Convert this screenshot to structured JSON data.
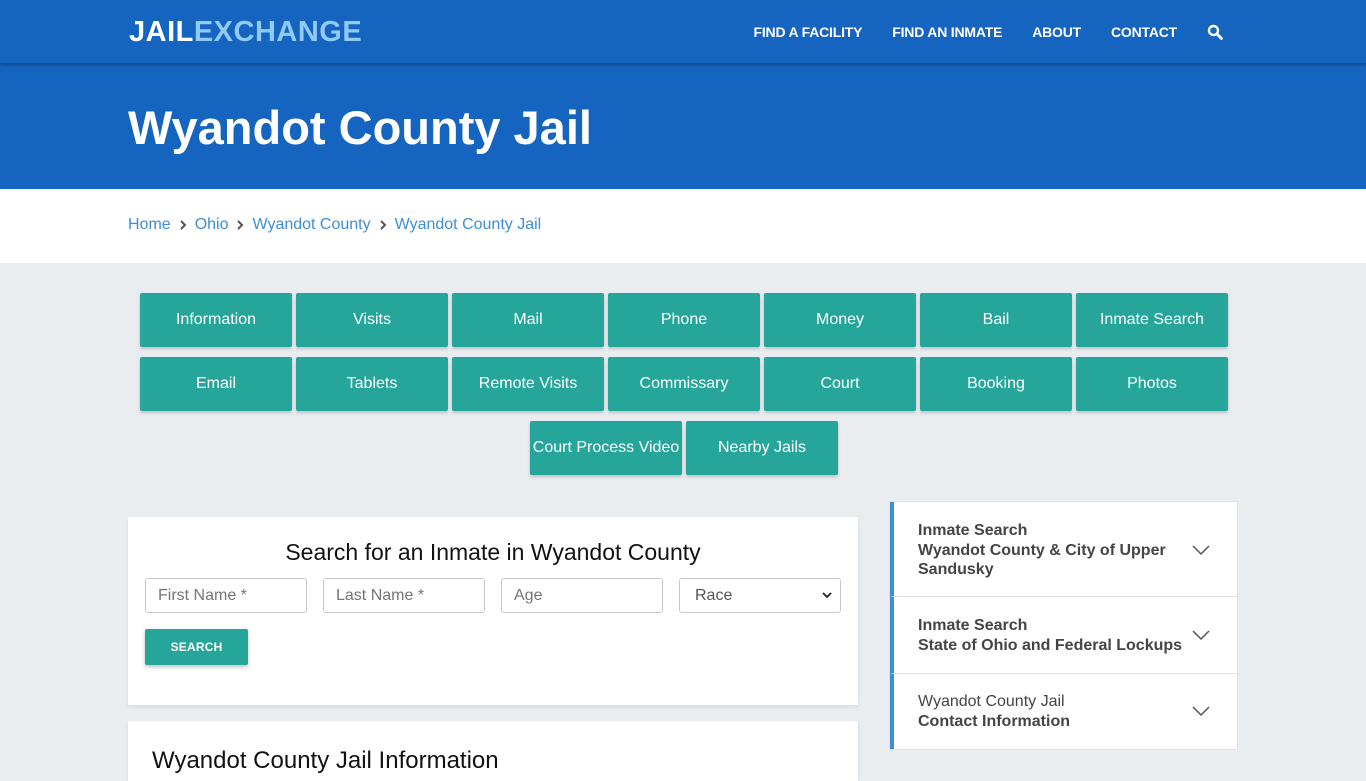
{
  "header": {
    "logo_part1": "JAIL",
    "logo_part2": "EXCHANGE",
    "nav": [
      "FIND A FACILITY",
      "FIND AN INMATE",
      "ABOUT",
      "CONTACT"
    ],
    "search_icon": "search-icon"
  },
  "hero": {
    "title": "Wyandot County Jail"
  },
  "breadcrumb": [
    "Home",
    "Ohio",
    "Wyandot County",
    "Wyandot County Jail"
  ],
  "tiles": [
    "Information",
    "Visits",
    "Mail",
    "Phone",
    "Money",
    "Bail",
    "Inmate Search",
    "Email",
    "Tablets",
    "Remote Visits",
    "Commissary",
    "Court",
    "Booking",
    "Photos",
    "Court Process Video",
    "Nearby Jails"
  ],
  "search": {
    "title": "Search for an Inmate in Wyandot County",
    "first_name_placeholder": "First Name *",
    "last_name_placeholder": "Last Name *",
    "age_placeholder": "Age",
    "race_selected": "Race",
    "button": "SEARCH"
  },
  "info": {
    "title": "Wyandot County Jail Information"
  },
  "sidebar": {
    "items": [
      {
        "line1": "Inmate Search",
        "line2": "Wyandot County & City of Upper Sandusky"
      },
      {
        "line1": "Inmate Search",
        "line2": "State of Ohio and Federal Lockups"
      },
      {
        "line1": "Wyandot County Jail",
        "line2": "Contact Information"
      }
    ]
  },
  "colors": {
    "primary_blue": "#1565c0",
    "logo_accent": "#90caf9",
    "teal": "#26a69a",
    "link_blue": "#3d8ed8",
    "page_bg": "#e9edf0"
  }
}
